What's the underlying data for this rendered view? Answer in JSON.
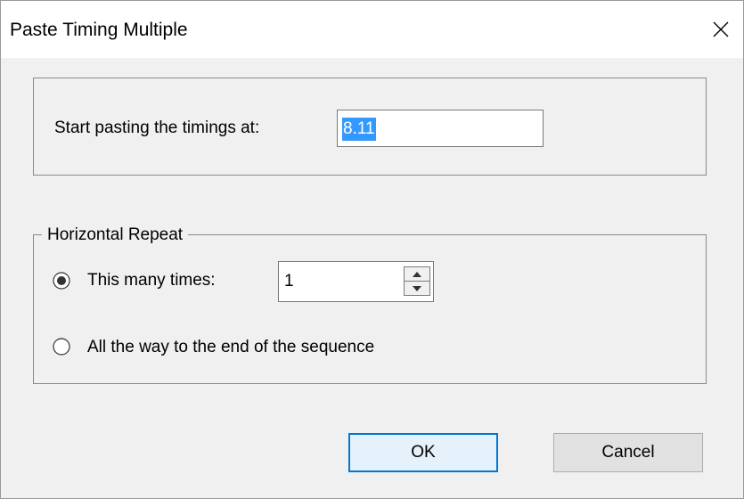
{
  "window": {
    "title": "Paste Timing Multiple"
  },
  "start": {
    "label": "Start pasting the timings at:",
    "value": "8.11"
  },
  "repeat": {
    "legend": "Horizontal Repeat",
    "option_times_label": "This many times:",
    "times_value": "1",
    "option_end_label": "All the way to the end of the sequence",
    "selected": "this-many-times"
  },
  "buttons": {
    "ok": "OK",
    "cancel": "Cancel"
  },
  "colors": {
    "selection": "#3399ff",
    "default_button_border": "#0078d7"
  }
}
